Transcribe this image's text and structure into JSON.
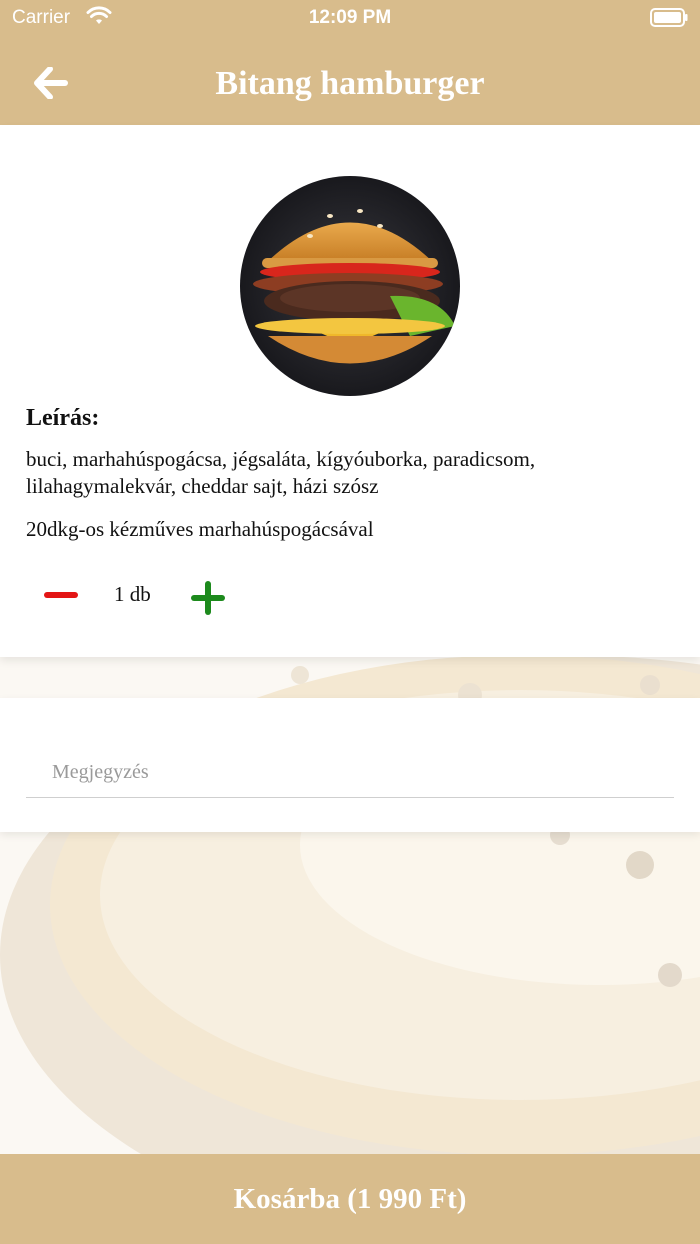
{
  "status_bar": {
    "carrier": "Carrier",
    "time": "12:09 PM"
  },
  "header": {
    "title": "Bitang hamburger",
    "back_icon": "arrow-left-icon"
  },
  "product": {
    "image_icon": "hamburger-photo",
    "description_heading": "Leírás:",
    "description": "buci, marhahúspogácsa, jégsaláta, kígyóuborka, paradicsom, lilahagymalekvár, cheddar sajt, házi szósz",
    "subtitle": "20dkg-os kézműves marhahúspogácsával",
    "quantity": "1 db"
  },
  "note": {
    "placeholder": "Megjegyzés",
    "value": ""
  },
  "cart_button": {
    "label": "Kosárba (1 990 Ft)"
  },
  "colors": {
    "accent": "#d8bc8c",
    "minus": "#e31515",
    "plus": "#1d8a1d"
  }
}
